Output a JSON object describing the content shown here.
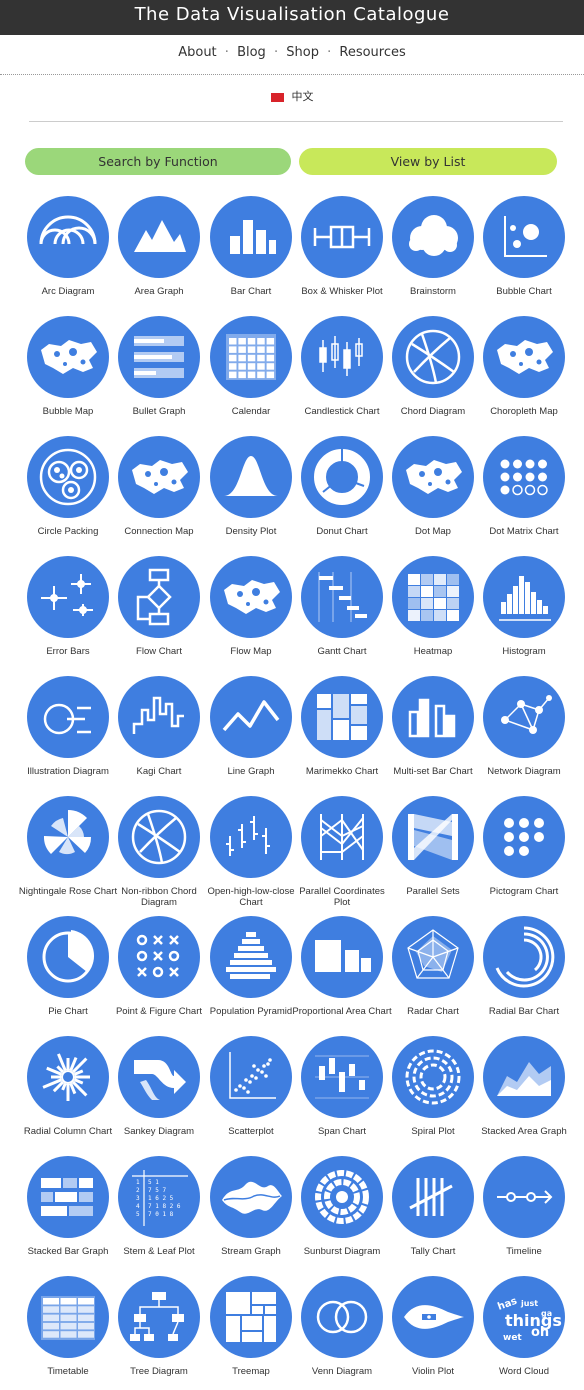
{
  "header": {
    "title": "The Data Visualisation Catalogue"
  },
  "nav": {
    "about": "About",
    "blog": "Blog",
    "shop": "Shop",
    "resources": "Resources",
    "separator": "·"
  },
  "language": {
    "label": "中文"
  },
  "buttons": {
    "search_by_function": "Search by Function",
    "view_by_list": "View by List"
  },
  "colors": {
    "circle": "#3f7ee0",
    "search_button": "#9bd77a",
    "list_button": "#c8e85a",
    "header": "#333333"
  },
  "charts": [
    {
      "label": "Arc Diagram",
      "icon": "arc"
    },
    {
      "label": "Area Graph",
      "icon": "area"
    },
    {
      "label": "Bar Chart",
      "icon": "bar"
    },
    {
      "label": "Box & Whisker Plot",
      "icon": "box"
    },
    {
      "label": "Brainstorm",
      "icon": "cloud"
    },
    {
      "label": "Bubble Chart",
      "icon": "bubble"
    },
    {
      "label": "Bubble Map",
      "icon": "map"
    },
    {
      "label": "Bullet Graph",
      "icon": "bullet"
    },
    {
      "label": "Calendar",
      "icon": "calendar"
    },
    {
      "label": "Candlestick Chart",
      "icon": "candle"
    },
    {
      "label": "Chord Diagram",
      "icon": "chord"
    },
    {
      "label": "Choropleth Map",
      "icon": "map"
    },
    {
      "label": "Circle Packing",
      "icon": "packing"
    },
    {
      "label": "Connection Map",
      "icon": "map"
    },
    {
      "label": "Density Plot",
      "icon": "density"
    },
    {
      "label": "Donut Chart",
      "icon": "donut"
    },
    {
      "label": "Dot Map",
      "icon": "map"
    },
    {
      "label": "Dot Matrix Chart",
      "icon": "dotmatrix"
    },
    {
      "label": "Error Bars",
      "icon": "error"
    },
    {
      "label": "Flow Chart",
      "icon": "flow"
    },
    {
      "label": "Flow Map",
      "icon": "map"
    },
    {
      "label": "Gantt Chart",
      "icon": "gantt"
    },
    {
      "label": "Heatmap",
      "icon": "heatmap"
    },
    {
      "label": "Histogram",
      "icon": "histogram"
    },
    {
      "label": "Illustration Diagram",
      "icon": "illustration"
    },
    {
      "label": "Kagi Chart",
      "icon": "kagi"
    },
    {
      "label": "Line Graph",
      "icon": "line"
    },
    {
      "label": "Marimekko Chart",
      "icon": "marimekko"
    },
    {
      "label": "Multi-set Bar Chart",
      "icon": "multibar"
    },
    {
      "label": "Network Diagram",
      "icon": "network"
    },
    {
      "label": "Nightingale Rose Chart",
      "icon": "rose"
    },
    {
      "label": "Non-ribbon Chord Diagram",
      "icon": "chord"
    },
    {
      "label": "Open-high-low-close Chart",
      "icon": "ohlc"
    },
    {
      "label": "Parallel Coordinates Plot",
      "icon": "parallel"
    },
    {
      "label": "Parallel Sets",
      "icon": "parallelsets"
    },
    {
      "label": "Pictogram Chart",
      "icon": "pictogram"
    },
    {
      "label": "Pie Chart",
      "icon": "pie"
    },
    {
      "label": "Point & Figure Chart",
      "icon": "pointfigure"
    },
    {
      "label": "Population Pyramid",
      "icon": "pyramid"
    },
    {
      "label": "Proportional Area Chart",
      "icon": "proparea"
    },
    {
      "label": "Radar Chart",
      "icon": "radar"
    },
    {
      "label": "Radial Bar Chart",
      "icon": "radialbar"
    },
    {
      "label": "Radial Column Chart",
      "icon": "radialcol"
    },
    {
      "label": "Sankey Diagram",
      "icon": "sankey"
    },
    {
      "label": "Scatterplot",
      "icon": "scatter"
    },
    {
      "label": "Span Chart",
      "icon": "span"
    },
    {
      "label": "Spiral Plot",
      "icon": "spiral"
    },
    {
      "label": "Stacked Area Graph",
      "icon": "stackedarea"
    },
    {
      "label": "Stacked Bar Graph",
      "icon": "stackedbar"
    },
    {
      "label": "Stem & Leaf Plot",
      "icon": "stemleaf"
    },
    {
      "label": "Stream Graph",
      "icon": "stream"
    },
    {
      "label": "Sunburst Diagram",
      "icon": "sunburst"
    },
    {
      "label": "Tally Chart",
      "icon": "tally"
    },
    {
      "label": "Timeline",
      "icon": "timeline"
    },
    {
      "label": "Timetable",
      "icon": "timetable"
    },
    {
      "label": "Tree Diagram",
      "icon": "tree"
    },
    {
      "label": "Treemap",
      "icon": "treemap"
    },
    {
      "label": "Venn Diagram",
      "icon": "venn"
    },
    {
      "label": "Violin Plot",
      "icon": "violin"
    },
    {
      "label": "Word Cloud",
      "icon": "wordcloud"
    }
  ]
}
